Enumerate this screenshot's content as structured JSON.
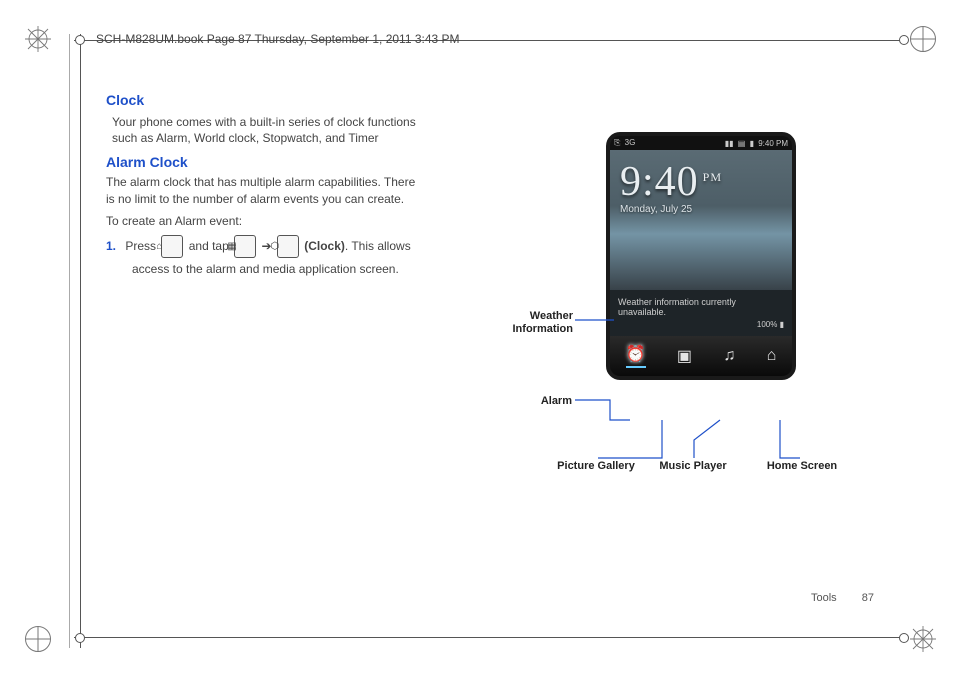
{
  "header": {
    "runhead": "SCH-M828UM.book  Page 87  Thursday, September 1, 2011  3:43 PM"
  },
  "section": {
    "title_clock": "Clock",
    "clock_desc": "Your phone comes with a built-in series of clock functions such as Alarm, World clock, Stopwatch, and Timer",
    "title_alarm": "Alarm Clock",
    "alarm_desc": "The alarm clock that has multiple alarm capabilities. There is no limit to the number of alarm events you can create.",
    "alarm_intro": "To create an Alarm event:",
    "step1_num": "1.",
    "step1_a": "Press",
    "step1_b": "and tap",
    "step1_arrow": "➔",
    "step1_c": "(Clock)",
    "step1_d": ". This allows access to the alarm and media application screen."
  },
  "inline_icons": {
    "home": "⌂",
    "apps": "▦",
    "clock": "⬡"
  },
  "phone": {
    "status": {
      "left_usb": "⎘",
      "left_3g": "3G",
      "sig": "▮▮",
      "net": "▤",
      "batt": "▮",
      "time": "9:40 PM"
    },
    "clock": {
      "time": "9:40",
      "ampm": "PM",
      "date": "Monday, July 25"
    },
    "weather": {
      "line": "Weather information currently unavailable.",
      "batt": "100% ▮"
    },
    "dock": {
      "alarm": "⏰",
      "gallery": "▣",
      "music": "♫",
      "home": "⌂"
    }
  },
  "callouts": {
    "weather1": "Weather",
    "weather2": "Information",
    "alarm": "Alarm",
    "picture": "Picture Gallery",
    "music": "Music Player",
    "home": "Home Screen"
  },
  "footer": {
    "section": "Tools",
    "page": "87"
  }
}
